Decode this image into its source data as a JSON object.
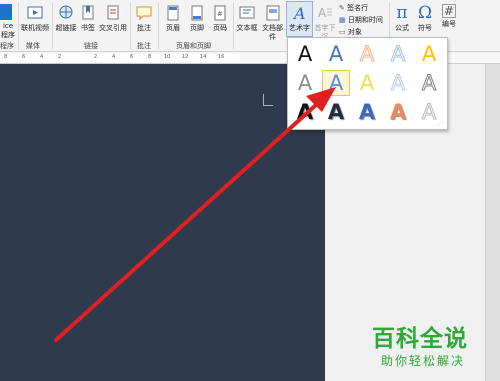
{
  "ribbon": {
    "buttons": {
      "office_apps": "ice\n程序",
      "online_video": "联机视频",
      "hyperlink": "超链接",
      "bookmark": "书签",
      "cross_ref": "交叉引用",
      "comment": "批注",
      "header": "页眉",
      "footer": "页脚",
      "page_number": "页码",
      "textbox": "文本框",
      "quick_parts": "文档部件",
      "wordart": "艺术字",
      "dropcap": "首字下沉",
      "signature_line": "签名行",
      "datetime": "日期和时间",
      "object": "对象",
      "equation": "公式",
      "symbol": "符号",
      "number": "编号"
    },
    "groups": {
      "program": "程序",
      "media": "媒体",
      "links": "链接",
      "comments": "批注",
      "header_footer": "页眉和页脚"
    }
  },
  "ruler": {
    "ticks": [
      "8",
      "6",
      "4",
      "2",
      "2",
      "4",
      "6",
      "8",
      "10",
      "12",
      "14",
      "16"
    ]
  },
  "wordart_gallery": {
    "rows": [
      [
        {
          "letter": "A",
          "style": "black-plain",
          "color": "#111111"
        },
        {
          "letter": "A",
          "style": "blue-fill",
          "color": "#4472c4"
        },
        {
          "letter": "A",
          "style": "orange-outline",
          "color": "#f4b183"
        },
        {
          "letter": "A",
          "style": "blue-outline-light",
          "color": "#9dc3e6"
        },
        {
          "letter": "A",
          "style": "gold-fill",
          "color": "#ffc000"
        }
      ],
      [
        {
          "letter": "A",
          "style": "gray-gradient",
          "color": "#8c8c8c"
        },
        {
          "letter": "A",
          "style": "blue-gradient",
          "color": "#5b8bd0"
        },
        {
          "letter": "A",
          "style": "yellow-gradient",
          "color": "#ffd54f"
        },
        {
          "letter": "A",
          "style": "blue-outline",
          "color": "#b7cde8"
        },
        {
          "letter": "A",
          "style": "gray-outline",
          "color": "#7f7f7f"
        }
      ],
      [
        {
          "letter": "A",
          "style": "black-shadow",
          "color": "#111111"
        },
        {
          "letter": "A",
          "style": "dark-shadow",
          "color": "#1f2d3d"
        },
        {
          "letter": "A",
          "style": "blue-bevel",
          "color": "#3a66c0"
        },
        {
          "letter": "A",
          "style": "orange-bevel",
          "color": "#f08a5d"
        },
        {
          "letter": "A",
          "style": "silver",
          "color": "#d9d9d9"
        }
      ]
    ]
  },
  "watermark": {
    "title": "百科全说",
    "subtitle": "助你轻松解决"
  },
  "colors": {
    "doc_background": "#2f3a4c",
    "arrow": "#e02020",
    "accent": "#2ea836"
  }
}
